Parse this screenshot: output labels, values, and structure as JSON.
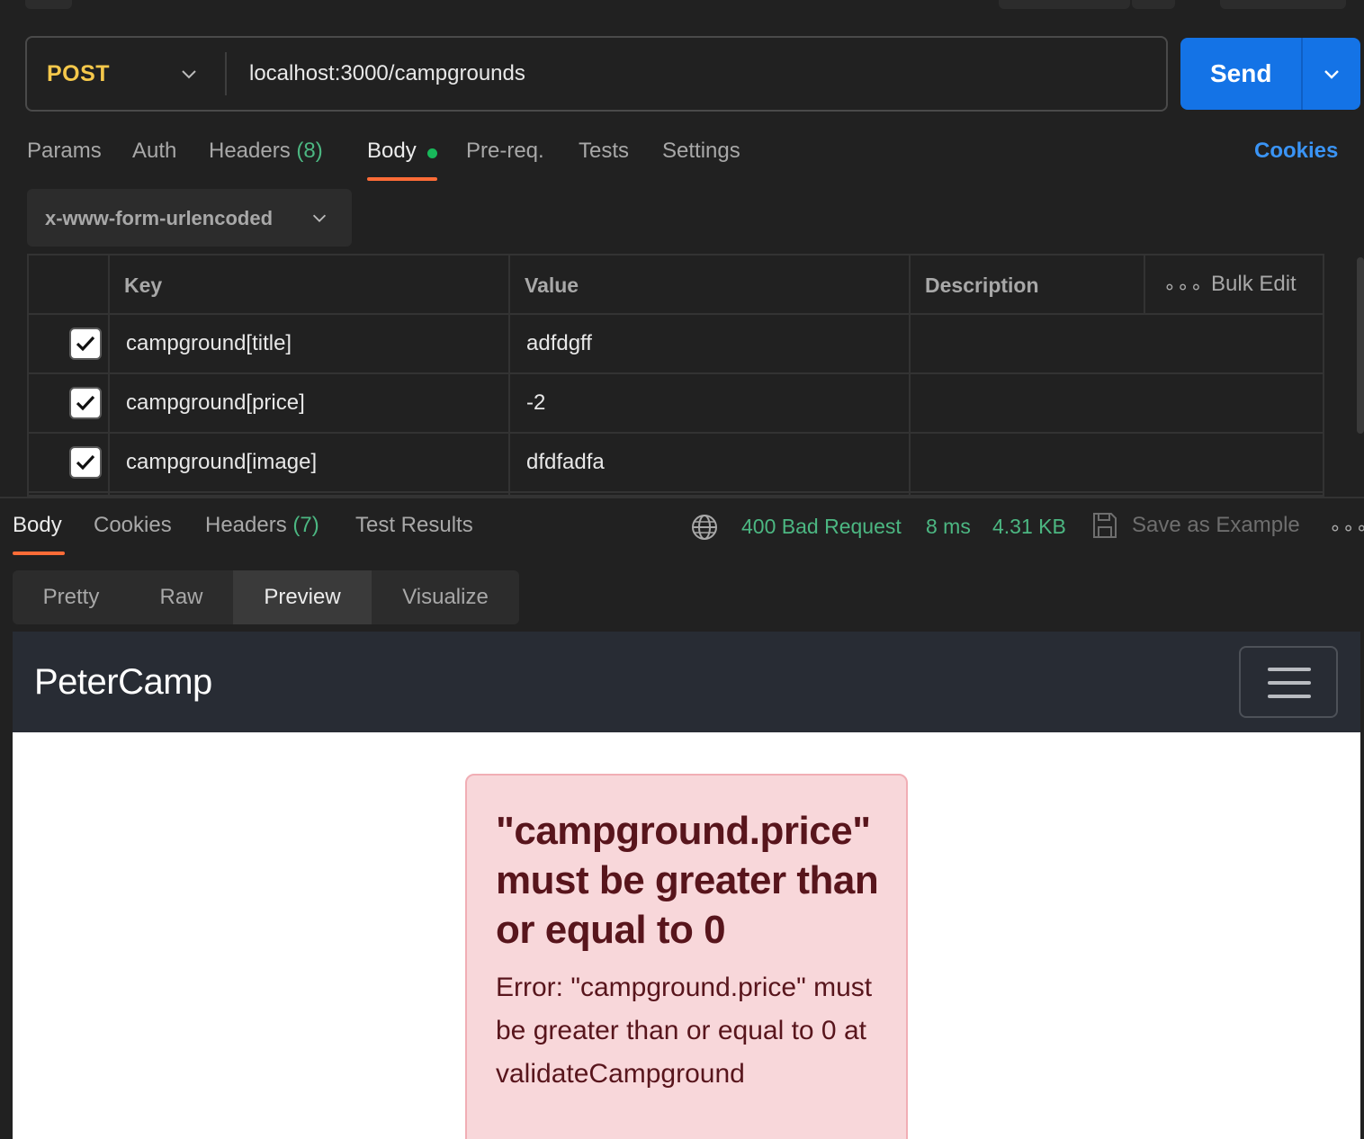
{
  "request": {
    "method": "POST",
    "url": "localhost:3000/campgrounds",
    "send_label": "Send"
  },
  "request_tabs": {
    "params": "Params",
    "auth": "Auth",
    "headers_label": "Headers",
    "headers_count": "(8)",
    "body": "Body",
    "prereq": "Pre-req.",
    "tests": "Tests",
    "settings": "Settings",
    "cookies": "Cookies"
  },
  "body_type": "x-www-form-urlencoded",
  "params_table": {
    "headers": {
      "key": "Key",
      "value": "Value",
      "description": "Description",
      "bulk_edit": "Bulk Edit"
    },
    "rows": [
      {
        "checked": true,
        "key": "campground[title]",
        "value": "adfdgff",
        "description": ""
      },
      {
        "checked": true,
        "key": "campground[price]",
        "value": "-2",
        "description": ""
      },
      {
        "checked": true,
        "key": "campground[image]",
        "value": "dfdfadfa",
        "description": ""
      }
    ]
  },
  "response_tabs": {
    "body": "Body",
    "cookies": "Cookies",
    "headers_label": "Headers",
    "headers_count": "(7)",
    "test_results": "Test Results"
  },
  "response_status": {
    "status": "400 Bad Request",
    "time": "8 ms",
    "size": "4.31 KB",
    "save_as_example": "Save as Example"
  },
  "view_tabs": {
    "pretty": "Pretty",
    "raw": "Raw",
    "preview": "Preview",
    "visualize": "Visualize"
  },
  "preview": {
    "brand": "PeterCamp",
    "alert_heading": "\"campground.price\" must be greater than or equal to 0",
    "alert_message": "Error: \"campground.price\" must be greater than or equal to 0 at validateCampground"
  },
  "colors": {
    "method": "#f5c84b",
    "send": "#1473e6",
    "accent_underline": "#ff6c37",
    "status_green": "#4cb782",
    "cookies_link": "#3a94f5",
    "alert_bg": "#f8d7da",
    "alert_text": "#58151c"
  }
}
